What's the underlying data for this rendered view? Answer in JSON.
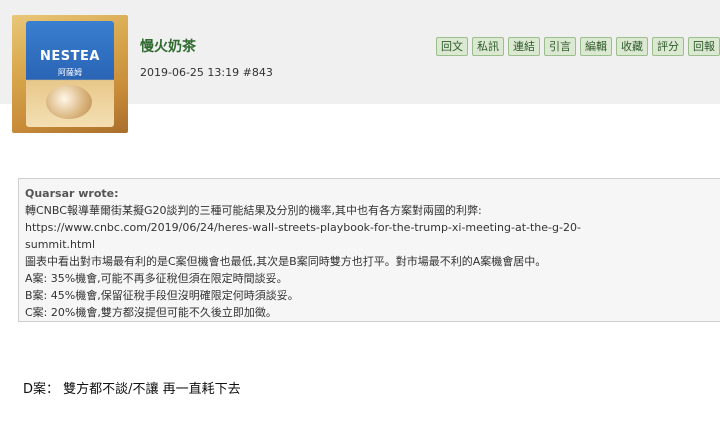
{
  "avatar": {
    "brand_text": "NESTEA",
    "sub_text": "阿薩姆"
  },
  "post": {
    "username": "慢火奶茶",
    "datetime": "2019-06-25 13:19",
    "floor": "#843"
  },
  "actions": [
    "回文",
    "私訊",
    "連結",
    "引言",
    "編輯",
    "收藏",
    "評分",
    "回報"
  ],
  "quote": {
    "author_line": "Quarsar wrote:",
    "lines": [
      "轉CNBC報導華爾街某擬G20談判的三種可能結果及分別的機率,其中也有各方案對兩國的利弊:",
      "https://www.cnbc.com/2019/06/24/heres-wall-streets-playbook-for-the-trump-xi-meeting-at-the-g-20-",
      "summit.html",
      "圖表中看出對市場最有利的是C案但機會也最低,其次是B案同時雙方也打平。對市場最不利的A案機會居中。",
      "A案: 35%機會,可能不再多征稅但須在限定時間談妥。",
      "B案: 45%機會,保留征稅手段但沒明確限定何時須談妥。",
      "C案: 20%機會,雙方都沒提但可能不久後立即加徵。"
    ]
  },
  "reply_text": "D案： 雙方都不談/不讓 再一直耗下去"
}
